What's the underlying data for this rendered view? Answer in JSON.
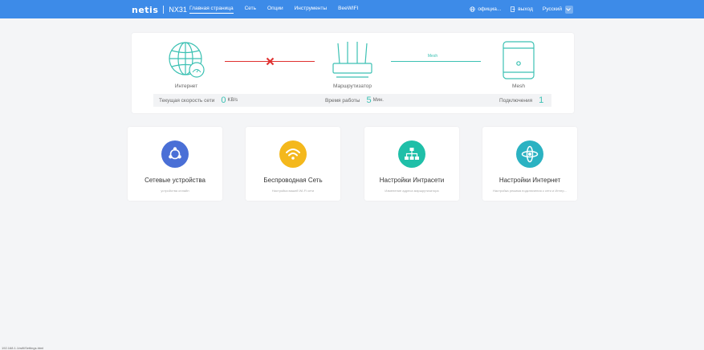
{
  "header": {
    "logo": "netis",
    "model": "NX31",
    "nav": [
      "Главная страница",
      "Сеть",
      "Опции",
      "Инструменты",
      "BeeWIFI"
    ],
    "official": "официа...",
    "logout": "выход",
    "language": "Русский"
  },
  "topology": {
    "internet_label": "Интернет",
    "router_label": "Маршрутизатор",
    "mesh_label": "Mesh",
    "mesh_link_tag": "Mesh",
    "internet_status": "disconnected",
    "colors": {
      "accent": "#3cc1b3",
      "error": "#e0302f"
    }
  },
  "stats": {
    "speed_label": "Текущая скорость сети",
    "speed_value": "0",
    "speed_unit": "KB/s",
    "uptime_label": "Время работы",
    "uptime_value": "5",
    "uptime_unit": "Мин.",
    "connections_label": "Подключения",
    "connections_value": "1"
  },
  "cards": [
    {
      "title": "Сетевые устройства",
      "subtitle": "устройства онлайн",
      "icon": "devices-icon",
      "color": "#4a6fd6"
    },
    {
      "title": "Беспроводная Сеть",
      "subtitle": "Настройка вашей Wi-Fi сети",
      "icon": "wifi-icon",
      "color": "#f4b81c"
    },
    {
      "title": "Настройки Интрасети",
      "subtitle": "Изменение адреса маршрутизатора",
      "icon": "lan-icon",
      "color": "#1fbfa8"
    },
    {
      "title": "Настройки Интернет",
      "subtitle": "Настройка режима подключения к сети и Интер...",
      "icon": "internet-icon",
      "color": "#2bb2c2"
    }
  ],
  "statusbar": "192.168.1.1/wifi/Settings.html"
}
